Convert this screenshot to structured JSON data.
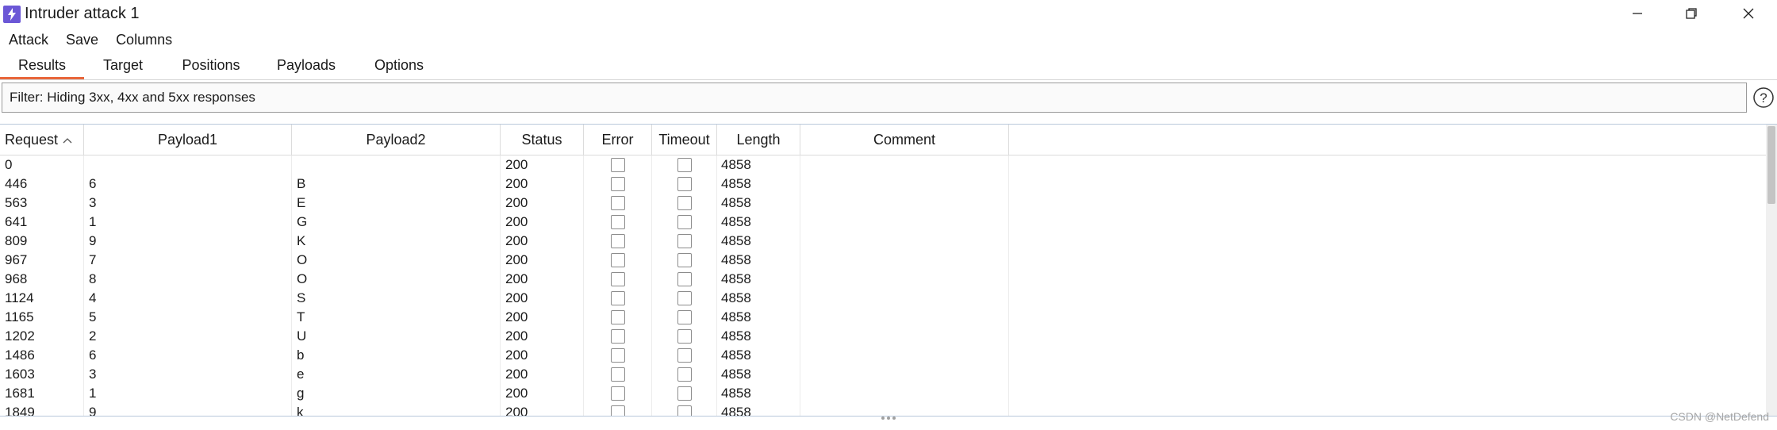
{
  "window": {
    "title": "Intruder attack 1",
    "accent": "#6b57d6"
  },
  "menu": [
    "Attack",
    "Save",
    "Columns"
  ],
  "tabs": {
    "items": [
      "Results",
      "Target",
      "Positions",
      "Payloads",
      "Options"
    ],
    "active": "Results",
    "active_color": "#e8663b"
  },
  "filter": {
    "text": "Filter: Hiding 3xx, 4xx and 5xx responses"
  },
  "table": {
    "columns": [
      "Request",
      "Payload1",
      "Payload2",
      "Status",
      "Error",
      "Timeout",
      "Length",
      "Comment"
    ],
    "sort_column": "Request",
    "sort_direction": "ascending",
    "rows": [
      {
        "request": "0",
        "payload1": "",
        "payload2": "",
        "status": "200",
        "error": false,
        "timeout": false,
        "length": "4858",
        "comment": ""
      },
      {
        "request": "446",
        "payload1": "6",
        "payload2": "B",
        "status": "200",
        "error": false,
        "timeout": false,
        "length": "4858",
        "comment": ""
      },
      {
        "request": "563",
        "payload1": "3",
        "payload2": "E",
        "status": "200",
        "error": false,
        "timeout": false,
        "length": "4858",
        "comment": ""
      },
      {
        "request": "641",
        "payload1": "1",
        "payload2": "G",
        "status": "200",
        "error": false,
        "timeout": false,
        "length": "4858",
        "comment": ""
      },
      {
        "request": "809",
        "payload1": "9",
        "payload2": "K",
        "status": "200",
        "error": false,
        "timeout": false,
        "length": "4858",
        "comment": ""
      },
      {
        "request": "967",
        "payload1": "7",
        "payload2": "O",
        "status": "200",
        "error": false,
        "timeout": false,
        "length": "4858",
        "comment": ""
      },
      {
        "request": "968",
        "payload1": "8",
        "payload2": "O",
        "status": "200",
        "error": false,
        "timeout": false,
        "length": "4858",
        "comment": ""
      },
      {
        "request": "1124",
        "payload1": "4",
        "payload2": "S",
        "status": "200",
        "error": false,
        "timeout": false,
        "length": "4858",
        "comment": ""
      },
      {
        "request": "1165",
        "payload1": "5",
        "payload2": "T",
        "status": "200",
        "error": false,
        "timeout": false,
        "length": "4858",
        "comment": ""
      },
      {
        "request": "1202",
        "payload1": "2",
        "payload2": "U",
        "status": "200",
        "error": false,
        "timeout": false,
        "length": "4858",
        "comment": ""
      },
      {
        "request": "1486",
        "payload1": "6",
        "payload2": "b",
        "status": "200",
        "error": false,
        "timeout": false,
        "length": "4858",
        "comment": ""
      },
      {
        "request": "1603",
        "payload1": "3",
        "payload2": "e",
        "status": "200",
        "error": false,
        "timeout": false,
        "length": "4858",
        "comment": ""
      },
      {
        "request": "1681",
        "payload1": "1",
        "payload2": "g",
        "status": "200",
        "error": false,
        "timeout": false,
        "length": "4858",
        "comment": ""
      },
      {
        "request": "1849",
        "payload1": "9",
        "payload2": "k",
        "status": "200",
        "error": false,
        "timeout": false,
        "length": "4858",
        "comment": ""
      }
    ]
  },
  "watermark": "CSDN @NetDefend"
}
